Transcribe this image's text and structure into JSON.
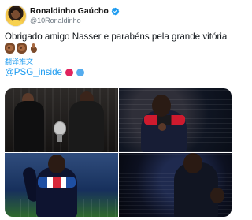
{
  "post": {
    "author": {
      "display_name": "Ronaldinho Gaúcho",
      "handle": "@10Ronaldinho"
    },
    "text": "Obrigado amigo Nasser e parabéns pela grande vitória",
    "emojis": [
      "clapping-hands",
      "clapping-hands",
      "pointing-hand"
    ],
    "translate_label": "翻译推文",
    "mention": "@PSG_inside",
    "mention_emojis": [
      "red-circle",
      "blue-circle"
    ],
    "colors": {
      "link": "#1d9bf0",
      "verified": "#1d9bf0",
      "red_circle": "#e0245e",
      "blue_circle": "#55acee"
    },
    "media": [
      {
        "name": "award-handshake-photo"
      },
      {
        "name": "psg-scarf-closeup-photo"
      },
      {
        "name": "stadium-scarf-photo"
      },
      {
        "name": "stadium-night-photo"
      }
    ]
  }
}
